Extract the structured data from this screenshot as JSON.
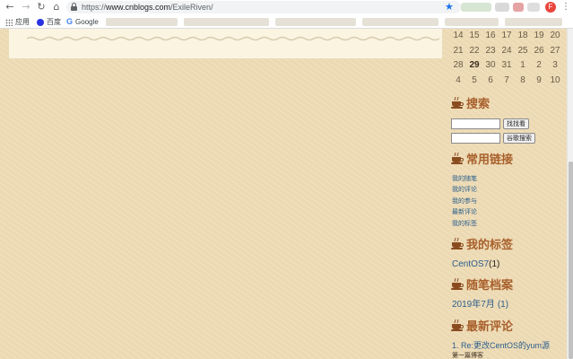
{
  "browser": {
    "url_scheme": "https://",
    "url_host": "www.cnblogs.com",
    "url_path": "/ExileRiven/",
    "profile_initial": "F",
    "bookmarks": [
      {
        "label": "应用",
        "icon": "apps-grid-icon"
      },
      {
        "label": "百度",
        "icon": "baidu-icon"
      },
      {
        "label": "Google",
        "icon": "google-icon"
      }
    ],
    "accent_color": "#1a73e8"
  },
  "calendar": {
    "rows": [
      [
        "14",
        "15",
        "16",
        "17",
        "18",
        "19",
        "20"
      ],
      [
        "21",
        "22",
        "23",
        "24",
        "25",
        "26",
        "27"
      ],
      [
        "28",
        "29",
        "30",
        "31",
        "1",
        "2",
        "3"
      ],
      [
        "4",
        "5",
        "6",
        "7",
        "8",
        "9",
        "10"
      ]
    ],
    "today": "29"
  },
  "search": {
    "title": "搜索",
    "find_button": "找找看",
    "google_button": "谷歌搜索"
  },
  "links": {
    "title": "常用链接",
    "items": [
      "我的随笔",
      "我的评论",
      "我的参与",
      "最新评论",
      "我的标签"
    ]
  },
  "tags": {
    "title": "我的标签",
    "items": [
      {
        "name": "CentOS7",
        "count": "(1)"
      }
    ]
  },
  "archive": {
    "title": "随笔档案",
    "items": [
      {
        "label": "2019年7月",
        "count": "(1)"
      }
    ]
  },
  "comments": {
    "title": "最新评论",
    "first": "1. Re:更改CentOS的yum源",
    "second": "第一篇博客"
  },
  "colors": {
    "background": "#efdcb6",
    "heading": "#a8602c",
    "link": "#2b5e8c"
  }
}
